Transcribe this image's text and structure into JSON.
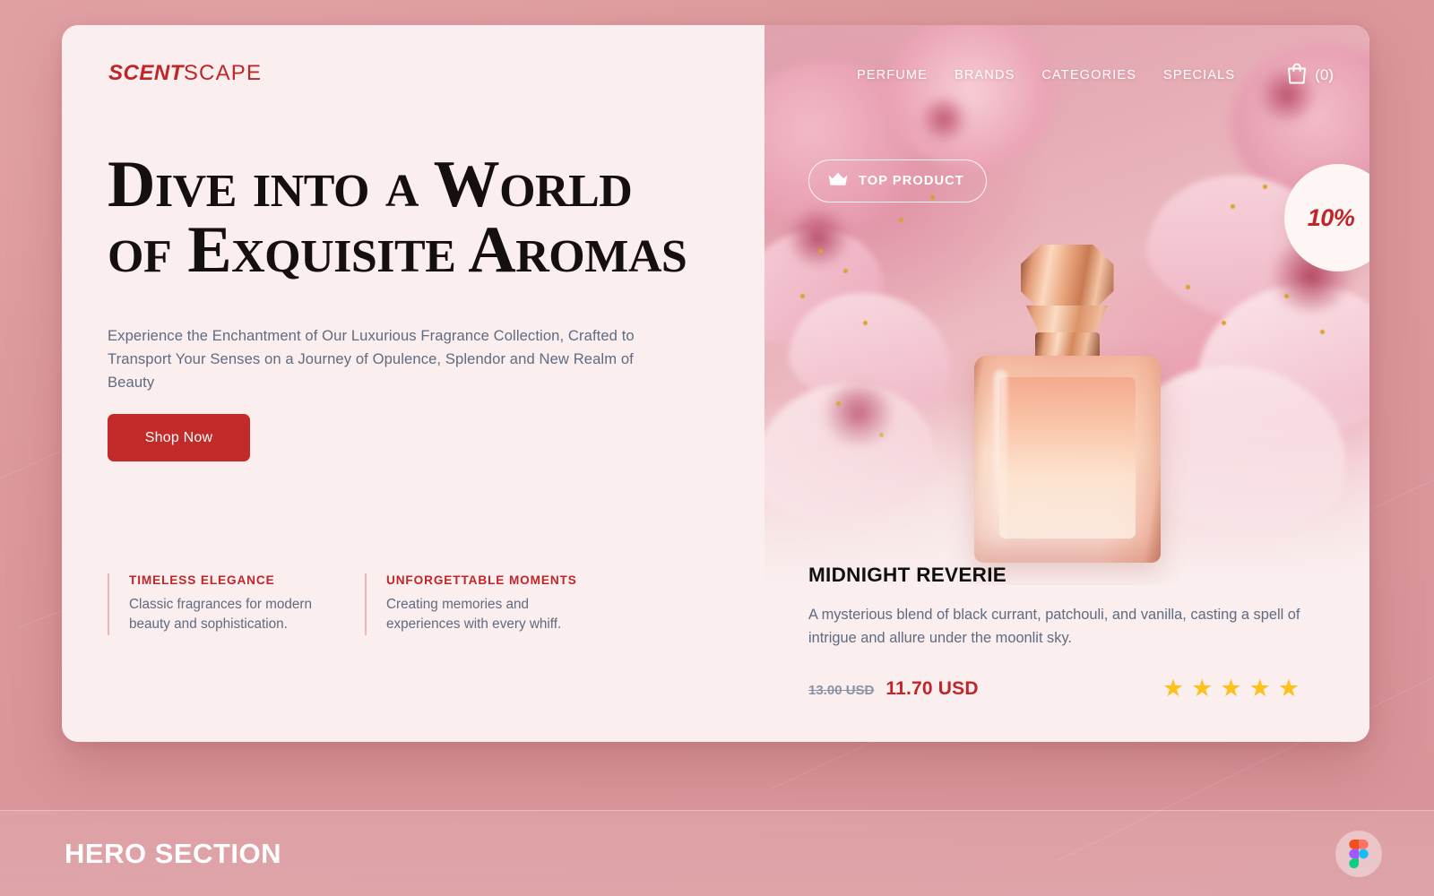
{
  "brand": {
    "bold_part": "SCENT",
    "light_part": "SCAPE"
  },
  "nav": {
    "links": [
      {
        "label": "PERFUME"
      },
      {
        "label": "BRANDS"
      },
      {
        "label": "CATEGORIES"
      },
      {
        "label": "SPECIALS"
      }
    ],
    "cart": {
      "icon": "shopping-bag-icon",
      "count_label": "(0)"
    }
  },
  "hero": {
    "headline_line1": "Dive into a World",
    "headline_line2": "of Exquisite Aromas",
    "subcopy": "Experience the Enchantment of Our Luxurious Fragrance Collection, Crafted to Transport Your Senses on a Journey of Opulence, Splendor and New Realm of Beauty",
    "cta_label": "Shop Now"
  },
  "features": [
    {
      "title": "TIMELESS ELEGANCE",
      "desc": "Classic fragrances for modern beauty and sophistication."
    },
    {
      "title": "UNFORGETTABLE MOMENTS",
      "desc": "Creating memories and experiences with every whiff."
    }
  ],
  "showcase": {
    "badge": {
      "icon": "crown-icon",
      "label": "TOP PRODUCT"
    },
    "discount": {
      "value": "10%"
    },
    "product": {
      "title": "MIDNIGHT REVERIE",
      "description": "A mysterious blend of black currant, patchouli, and vanilla, casting a spell of intrigue and allure under the moonlit sky.",
      "old_price": "13.00 USD",
      "new_price": "11.70 USD",
      "rating": 5,
      "star_glyph": "★"
    }
  },
  "footer": {
    "title": "HERO SECTION",
    "logo": "figma-logo"
  },
  "colors": {
    "page_background": "#dd9a9e",
    "card_background": "#faeeee",
    "brand_red": "#c0252a",
    "cta_red": "#c32b2b",
    "body_text": "#5f6b80",
    "star_gold": "#fcc21b"
  }
}
